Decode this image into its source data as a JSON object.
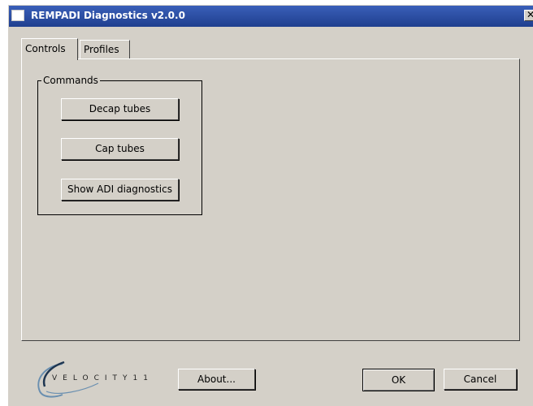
{
  "window": {
    "title": "REMPADI Diagnostics v2.0.0",
    "close_glyph": "✕"
  },
  "tabs": [
    {
      "label": "Controls",
      "active": true
    },
    {
      "label": "Profiles",
      "active": false
    }
  ],
  "commands": {
    "group_label": "Commands",
    "buttons": [
      {
        "label": "Decap tubes"
      },
      {
        "label": "Cap tubes"
      },
      {
        "label": "Show ADI diagnostics"
      }
    ]
  },
  "footer": {
    "logo_text": "VELOCITY11",
    "about_label": "About...",
    "ok_label": "OK",
    "cancel_label": "Cancel"
  },
  "colors": {
    "titlebar": "#2e4fa0",
    "dialog_face": "#d4d0c8",
    "logo_accent": "#6a8fb0"
  }
}
